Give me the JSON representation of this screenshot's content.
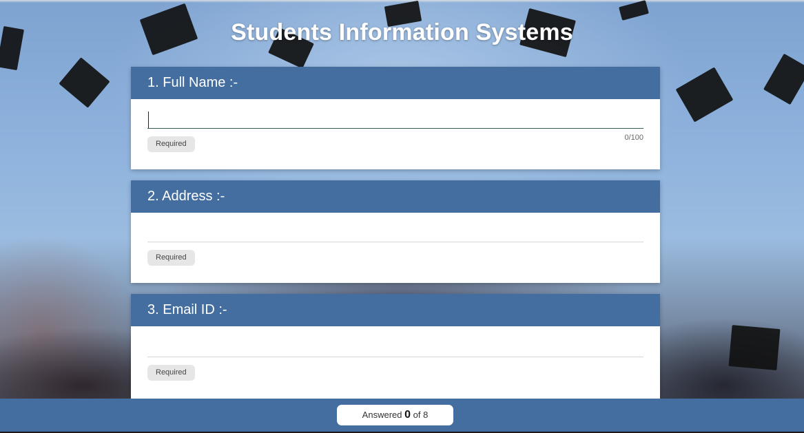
{
  "page": {
    "title": "Students Information Systems",
    "background_color": "#8fb3dd",
    "header_color": "#436e9f"
  },
  "questions": [
    {
      "label": "1. Full Name :-",
      "value": "",
      "placeholder": "",
      "counter": "0/100",
      "required_label": "Required"
    },
    {
      "label": "2. Address :-",
      "value": "",
      "placeholder": "",
      "required_label": "Required"
    },
    {
      "label": "3. Email ID :-",
      "value": "",
      "placeholder": "",
      "required_label": "Required"
    }
  ],
  "footer": {
    "answered_prefix": "Answered",
    "answered_count": "0",
    "answered_suffix": "of 8"
  }
}
